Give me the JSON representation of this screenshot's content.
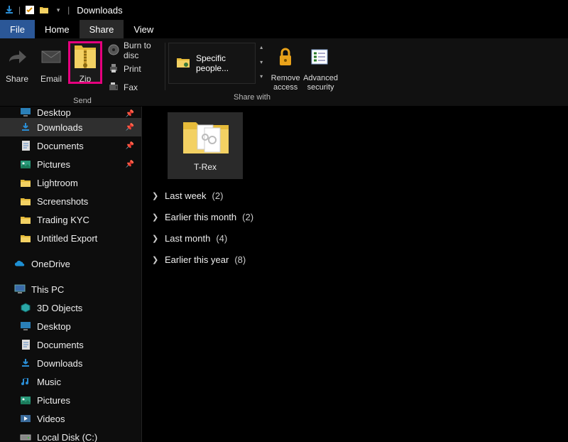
{
  "title": "Downloads",
  "menu": {
    "file": "File",
    "home": "Home",
    "share": "Share",
    "view": "View"
  },
  "ribbon": {
    "share": "Share",
    "email": "Email",
    "zip": "Zip",
    "burn": "Burn to disc",
    "print": "Print",
    "fax": "Fax",
    "send_group": "Send",
    "specific": "Specific people...",
    "share_with_group": "Share with",
    "remove_access_l1": "Remove",
    "remove_access_l2": "access",
    "adv_sec_l1": "Advanced",
    "adv_sec_l2": "security"
  },
  "nav": {
    "quick": [
      {
        "label": "Desktop",
        "icon": "desktop",
        "pinned": true,
        "cut": true
      },
      {
        "label": "Downloads",
        "icon": "downloads",
        "pinned": true,
        "selected": true
      },
      {
        "label": "Documents",
        "icon": "documents",
        "pinned": true
      },
      {
        "label": "Pictures",
        "icon": "pictures",
        "pinned": true
      },
      {
        "label": "Lightroom",
        "icon": "folder"
      },
      {
        "label": "Screenshots",
        "icon": "folder"
      },
      {
        "label": "Trading KYC",
        "icon": "folder"
      },
      {
        "label": "Untitled Export",
        "icon": "folder"
      }
    ],
    "onedrive": "OneDrive",
    "thispc": "This PC",
    "pc": [
      {
        "label": "3D Objects",
        "icon": "3d"
      },
      {
        "label": "Desktop",
        "icon": "desktop"
      },
      {
        "label": "Documents",
        "icon": "documents"
      },
      {
        "label": "Downloads",
        "icon": "downloads"
      },
      {
        "label": "Music",
        "icon": "music"
      },
      {
        "label": "Pictures",
        "icon": "pictures"
      },
      {
        "label": "Videos",
        "icon": "videos"
      },
      {
        "label": "Local Disk (C:)",
        "icon": "disk"
      }
    ]
  },
  "content": {
    "item": "T-Rex",
    "groups": [
      {
        "label": "Last week",
        "count": "(2)"
      },
      {
        "label": "Earlier this month",
        "count": "(2)"
      },
      {
        "label": "Last month",
        "count": "(4)"
      },
      {
        "label": "Earlier this year",
        "count": "(8)"
      }
    ]
  }
}
